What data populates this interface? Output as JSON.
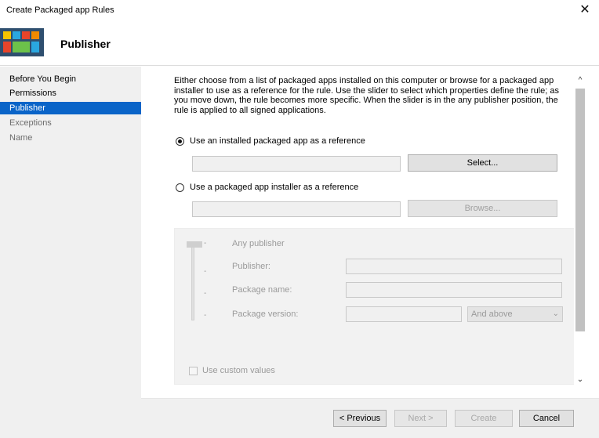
{
  "window": {
    "title": "Create Packaged app Rules",
    "close_glyph": "✕"
  },
  "header": {
    "title": "Publisher",
    "icon": "packaged-app-icon"
  },
  "sidebar": {
    "items": [
      {
        "label": "Before You Begin",
        "state": "normal"
      },
      {
        "label": "Permissions",
        "state": "normal"
      },
      {
        "label": "Publisher",
        "state": "selected"
      },
      {
        "label": "Exceptions",
        "state": "disabled"
      },
      {
        "label": "Name",
        "state": "disabled"
      }
    ]
  },
  "main": {
    "intro": "Either choose from a list of packaged apps installed on this computer or browse for a packaged app installer to use as a reference for the rule. Use the slider to select which properties define the rule; as you move down, the rule becomes more specific. When the slider is in the any publisher position, the rule is applied to all signed applications.",
    "option_installed": {
      "label": "Use an installed packaged app as a reference",
      "checked": true
    },
    "installed_value": "",
    "select_button": "Select...",
    "option_installer": {
      "label": "Use a packaged app installer as a reference",
      "checked": false
    },
    "installer_value": "",
    "browse_button": "Browse...",
    "group": {
      "any_publisher": "Any publisher",
      "publisher_label": "Publisher:",
      "publisher_value": "",
      "package_name_label": "Package name:",
      "package_name_value": "",
      "package_version_label": "Package version:",
      "package_version_value": "",
      "version_combo": "And above",
      "custom_values": "Use custom values",
      "custom_checked": false
    }
  },
  "scrollbar": {
    "up": "^",
    "down": "⌄"
  },
  "footer": {
    "previous": "< Previous",
    "next": "Next >",
    "create": "Create",
    "cancel": "Cancel"
  },
  "colors": {
    "selected_bg": "#0a64c8",
    "sidebar_bg": "#f0f0f0",
    "footer_bg": "#f0f0f0"
  }
}
